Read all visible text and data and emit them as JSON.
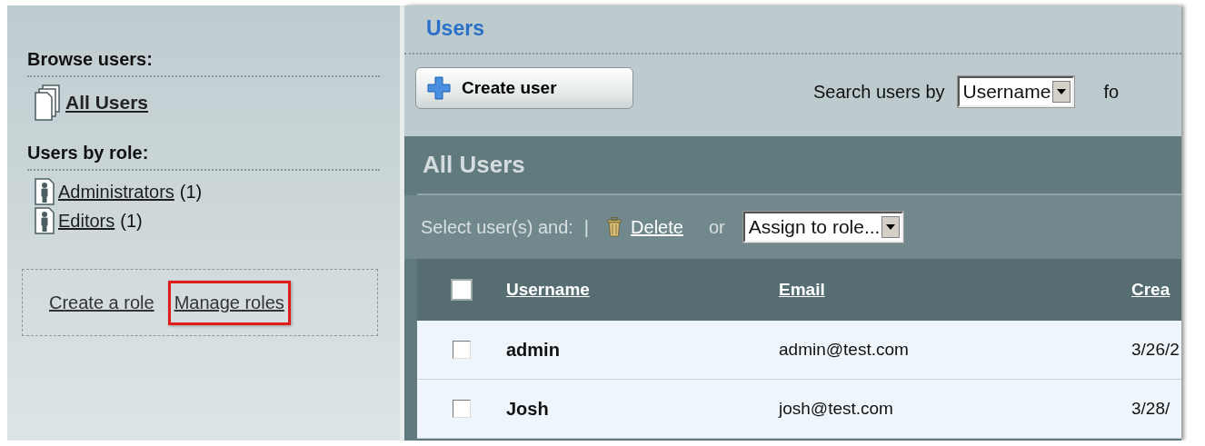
{
  "sidebar": {
    "sections": [
      {
        "heading": "Browse users:",
        "items": [
          {
            "kind": "all",
            "label": "All Users"
          }
        ]
      },
      {
        "heading": "Users by role:",
        "items": [
          {
            "kind": "role",
            "label": "Administrators",
            "count": "(1)"
          },
          {
            "kind": "role",
            "label": "Editors",
            "count": "(1)"
          }
        ]
      }
    ],
    "actions": [
      {
        "label": "Create a role",
        "highlighted": false
      },
      {
        "label": "Manage roles",
        "highlighted": true
      }
    ]
  },
  "page": {
    "title": "Users",
    "create_button": "Create user",
    "search_label": "Search users by",
    "search_field": "Username",
    "search_suffix": "fo"
  },
  "panel": {
    "title": "All Users",
    "toolbar": {
      "prefix": "Select user(s) and:",
      "separator": "|",
      "delete": "Delete",
      "or": "or",
      "assign": "Assign to role..."
    },
    "table": {
      "select_all": {
        "checked": false
      },
      "columns": [
        "Username",
        "Email",
        "Crea"
      ],
      "rows": [
        {
          "checked": false,
          "username": "admin",
          "email": "admin@test.com",
          "created": "3/26/2"
        },
        {
          "checked": false,
          "username": "Josh",
          "email": "josh@test.com",
          "created": "3/28/"
        }
      ]
    }
  }
}
